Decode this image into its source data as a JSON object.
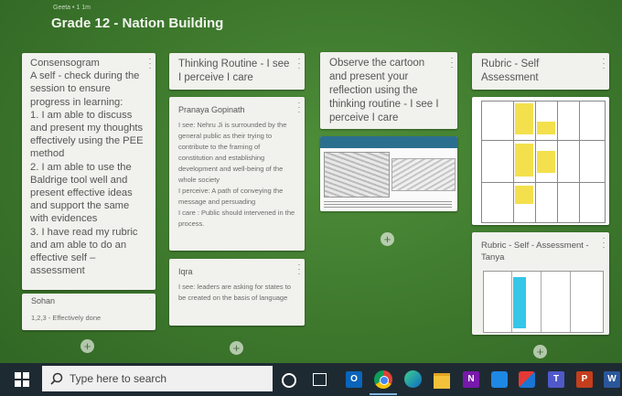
{
  "board": {
    "author": "Geeta • 1     1m",
    "title": "Grade 12 - Nation Building"
  },
  "columns": [
    {
      "header": "Consensogram\nA self - check during the session to ensure progress in learning:\n1. I am able to discuss and present my thoughts effectively using the PEE method\n2. I am able to use the Baldrige tool well and present effective ideas and support the same with evidences\n3. I have read my rubric and am able to do an effective self – assessment",
      "posts": [
        {
          "title": "Sohan",
          "body": "1,2,3 - Effectively done"
        }
      ]
    },
    {
      "header": "Thinking Routine - I see I perceive I care",
      "posts": [
        {
          "title": "Pranaya Gopinath",
          "body": "I see:  Nehru Ji is surrounded by the general public as their trying to contribute to the framing of constitution and establishing development and well-being of the whole society\nI perceive: A path of conveying the message and persuading\nI care : Public should intervened in the process."
        },
        {
          "title": "Iqra",
          "body": "I see: leaders are asking for states to be created on the basis of language"
        }
      ]
    },
    {
      "header": "Observe the cartoon and present your reflection using the thinking routine - I see I perceive I care",
      "posts": []
    },
    {
      "header": "Rubric - Self Assessment",
      "posts": [
        {
          "title": "Rubric - Self - Assessment - Tanya",
          "body": ""
        }
      ]
    }
  ],
  "add_post_label": "+",
  "taskbar": {
    "search_placeholder": "Type here to search",
    "apps": [
      "windows-icon",
      "cortana-icon",
      "task-view-icon",
      "outlook-icon",
      "chrome-icon",
      "edge-icon",
      "file-explorer-icon",
      "onenote-icon",
      "wordperfect-icon",
      "snipping-tool-icon",
      "teams-icon",
      "powerpoint-icon",
      "word-icon"
    ],
    "app_badges": {
      "outlook": "O",
      "onenote": "N",
      "powerpoint": "P",
      "word": "W",
      "teams": "T"
    }
  },
  "colors": {
    "background": "#3f7a2e",
    "card": "#f1f1ed",
    "taskbar": "#1e2a32",
    "rubric_highlight": "#f4e04d",
    "rubric_highlight2": "#35c6e8"
  }
}
